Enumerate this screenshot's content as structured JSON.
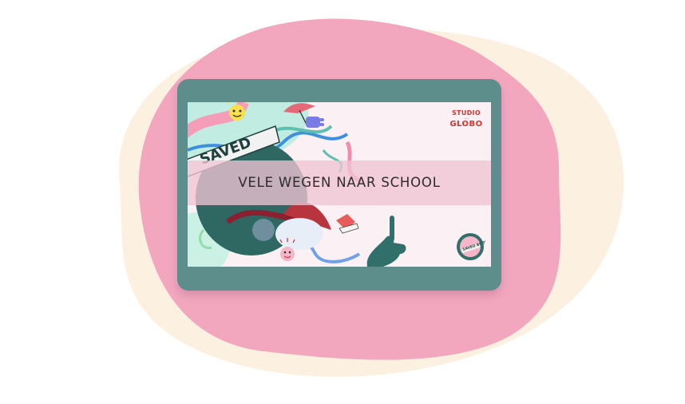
{
  "screen": {
    "title": "VELE WEGEN NAAR SCHOOL",
    "logo": {
      "line1": "STUDIO",
      "line2": "GLOBO"
    },
    "artwork_texts": {
      "main_sticker": "SAVED",
      "badge": "SAVED BY THE BELL"
    }
  },
  "colors": {
    "blob_cream": "#fcf1e0",
    "blob_pink": "#f2a7bf",
    "tablet_frame": "#5e8e8c",
    "screen_background": "#fbf1f4",
    "title_band": "#f0c4d4",
    "logo_red": "#d9332f"
  },
  "icons": [
    "smiley-icon",
    "hand-icon",
    "umbrella-icon",
    "pointing-hand-icon",
    "sneaker-icon"
  ]
}
